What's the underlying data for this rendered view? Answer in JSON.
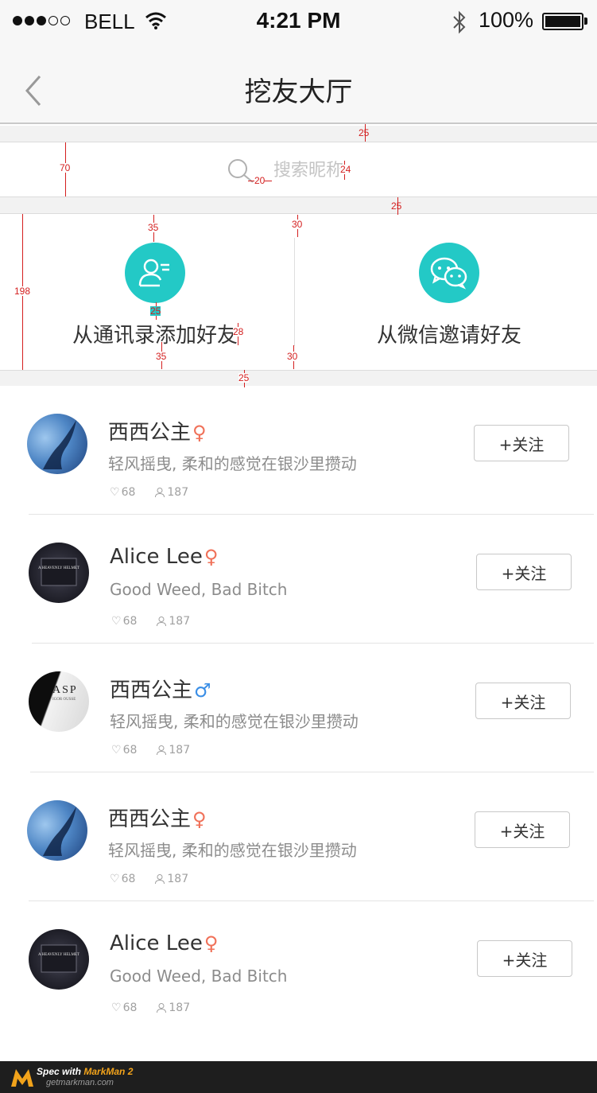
{
  "status_bar": {
    "carrier": "BELL",
    "time": "4:21 PM",
    "battery": "100%"
  },
  "nav": {
    "title": "挖友大厅"
  },
  "search": {
    "placeholder": "搜索昵称"
  },
  "invite": {
    "contacts_label": "从通讯录添加好友",
    "wechat_label": "从微信邀请好友"
  },
  "users": [
    {
      "name": "西西公主",
      "gender": "♀",
      "motto": "轻风摇曳, 柔和的感觉在银沙里攒动",
      "likes": "68",
      "followers": "187",
      "follow_label": "+关注"
    },
    {
      "name": "Alice Lee",
      "gender": "♀",
      "motto": "Good Weed, Bad Bitch",
      "likes": "68",
      "followers": "187",
      "follow_label": "+关注"
    },
    {
      "name": "西西公主",
      "gender": "♂",
      "motto": "轻风摇曳, 柔和的感觉在银沙里攒动",
      "likes": "68",
      "followers": "187",
      "follow_label": "+关注"
    },
    {
      "name": "西西公主",
      "gender": "♀",
      "motto": "轻风摇曳, 柔和的感觉在银沙里攒动",
      "likes": "68",
      "followers": "187",
      "follow_label": "+关注"
    },
    {
      "name": "Alice Lee",
      "gender": "♀",
      "motto": "Good Weed, Bad Bitch",
      "likes": "68",
      "followers": "187",
      "follow_label": "+关注"
    }
  ],
  "avatar_text": {
    "helmet": "A HEAVENLY HELMET",
    "asp": "ASP",
    "asp_sub": "IGOR OUSSE"
  },
  "spec_labels": [
    "25",
    "70",
    "20",
    "24",
    "25",
    "35",
    "30",
    "198",
    "25",
    "28",
    "35",
    "30",
    "25"
  ],
  "footer": {
    "spec_prefix": "Spec with",
    "brand": "MarkMan 2",
    "site": "getmarkman.com"
  },
  "colors": {
    "accent": "#23c9c6",
    "female": "#f07159",
    "male": "#3a8ee6",
    "spec": "#d41f1f"
  }
}
